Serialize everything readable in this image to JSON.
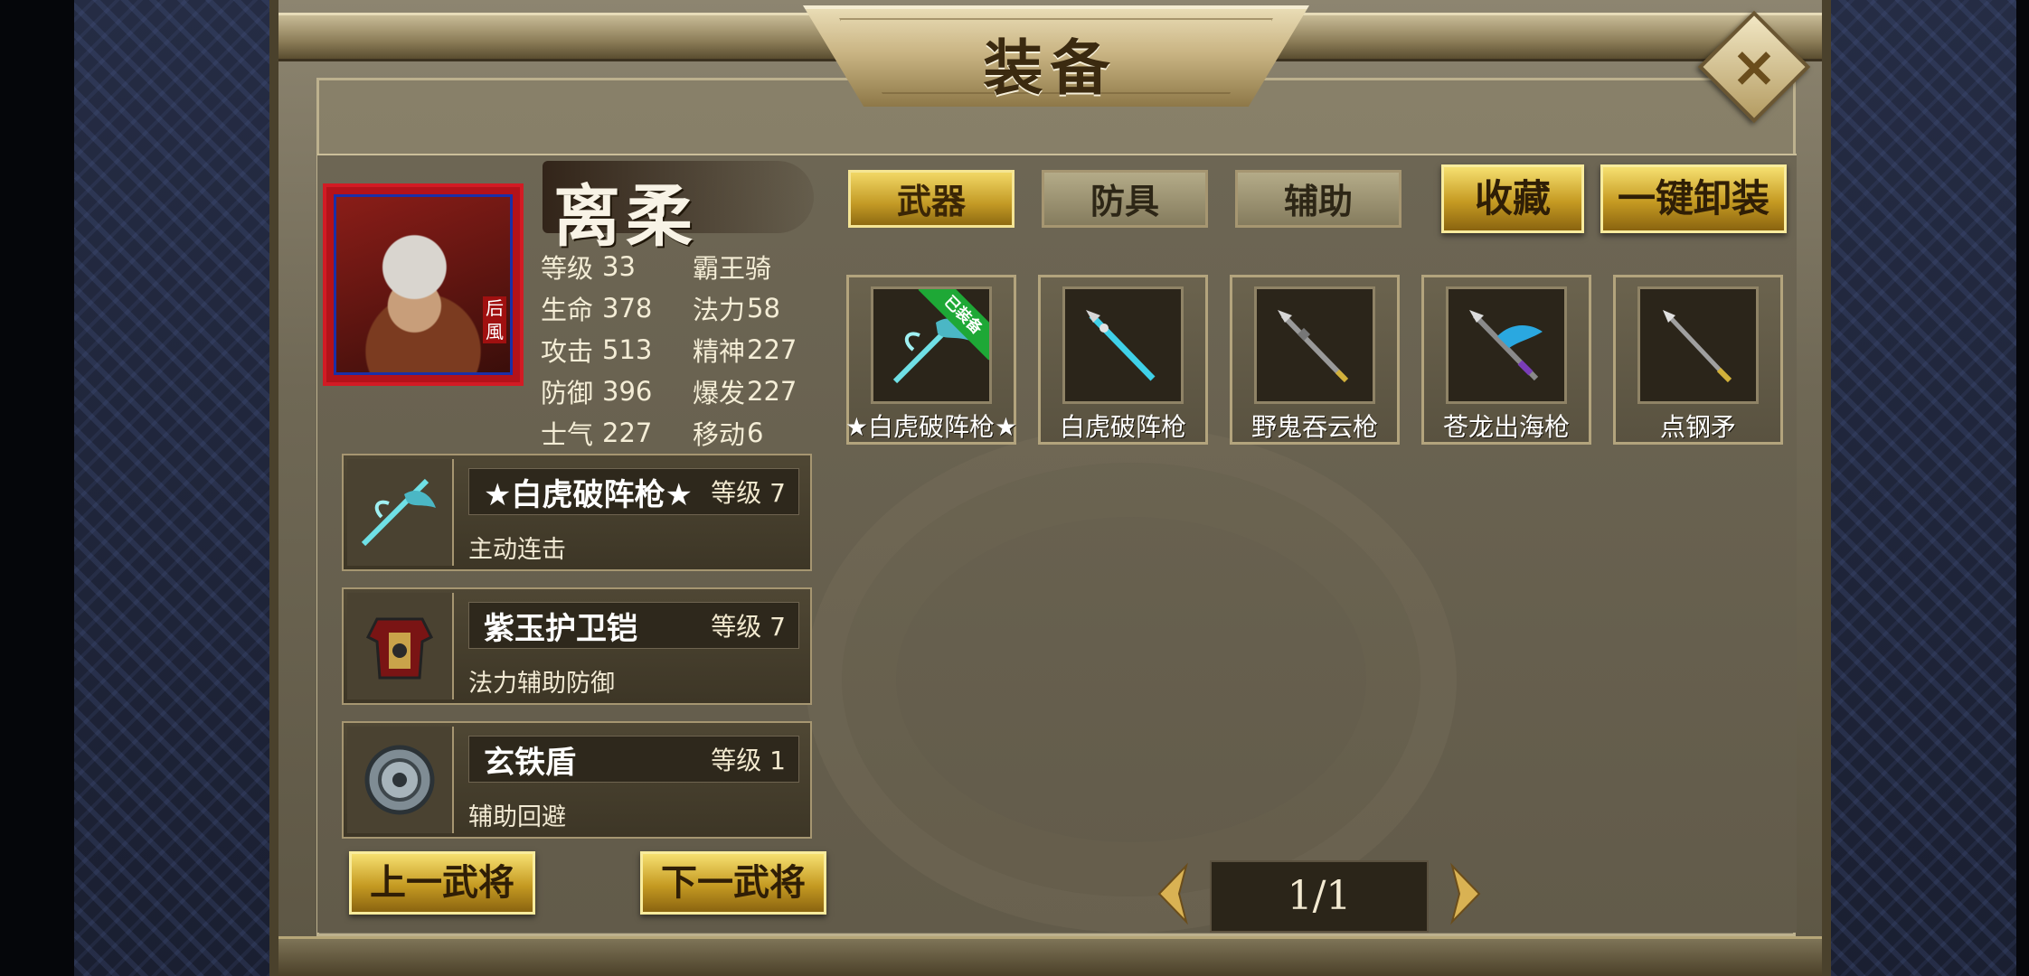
{
  "title": "装备",
  "close_label": "×",
  "hero": {
    "name": "离柔",
    "portrait_tag": "后風",
    "class": "霸王骑",
    "stats": [
      {
        "label": "等级",
        "value": "33",
        "label2": "",
        "value2": ""
      },
      {
        "label": "生命",
        "value": "378",
        "label2": "法力",
        "value2": "58"
      },
      {
        "label": "攻击",
        "value": "513",
        "label2": "精神",
        "value2": "227"
      },
      {
        "label": "防御",
        "value": "396",
        "label2": "爆发",
        "value2": "227"
      },
      {
        "label": "士气",
        "value": "227",
        "label2": "移动",
        "value2": "6"
      }
    ]
  },
  "equipped": [
    {
      "name": "★白虎破阵枪★",
      "level": "等级 7",
      "desc": "主动连击",
      "icon": "white-tiger-spear-icon"
    },
    {
      "name": "紫玉护卫铠",
      "level": "等级 7",
      "desc": "法力辅助防御",
      "icon": "armor-icon"
    },
    {
      "name": "玄铁盾",
      "level": "等级 1",
      "desc": "辅助回避",
      "icon": "shield-icon"
    }
  ],
  "nav": {
    "prev": "上一武将",
    "next": "下一武将"
  },
  "tabs": [
    {
      "label": "武器",
      "active": true
    },
    {
      "label": "防具",
      "active": false
    },
    {
      "label": "辅助",
      "active": false
    }
  ],
  "actions": {
    "favorite": "收藏",
    "unequip_all": "一键卸装"
  },
  "weapons": [
    {
      "name": "★白虎破阵枪★",
      "equipped": true,
      "badge": "已装备"
    },
    {
      "name": "白虎破阵枪",
      "equipped": false
    },
    {
      "name": "野鬼吞云枪",
      "equipped": false
    },
    {
      "name": "苍龙出海枪",
      "equipped": false
    },
    {
      "name": "点钢矛",
      "equipped": false
    }
  ],
  "pager": {
    "text": "1/1"
  },
  "colors": {
    "gold": "#c59a22",
    "equipped_badge": "#1ea836",
    "portrait_frame": "#d21b24"
  }
}
